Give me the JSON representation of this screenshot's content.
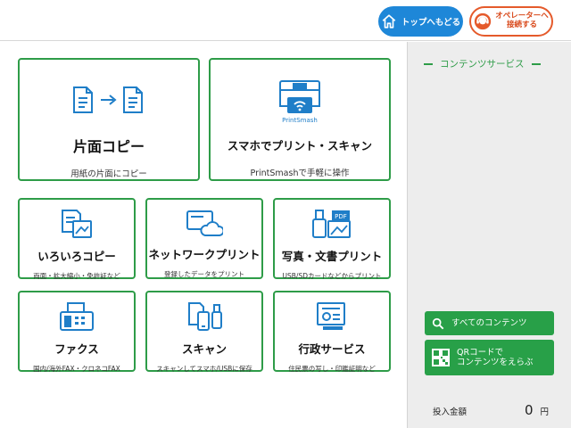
{
  "header": {
    "top_button_label": "トップへもどる",
    "operator_button_label": "オペレーターへ\n接続する"
  },
  "tiles": {
    "single_copy": {
      "title": "片面コピー",
      "desc": "用紙の片面にコピー"
    },
    "smartphone": {
      "title": "スマホでプリント・スキャン",
      "desc": "PrintSmashで手軽に操作",
      "icon_text": "PrintSmash"
    },
    "various_copy": {
      "title": "いろいろコピー",
      "desc": "両面・拡大縮小・免許証など"
    },
    "network_print": {
      "title": "ネットワークプリント",
      "desc": "登録したデータをプリント"
    },
    "photo_print": {
      "title": "写真・文書プリント",
      "desc": "USB/SDカードなどからプリント"
    },
    "fax": {
      "title": "ファクス",
      "desc": "国内/海外FAX・クロネコFAX"
    },
    "scan": {
      "title": "スキャン",
      "desc": "スキャンしてスマホ/USBに保存"
    },
    "admin": {
      "title": "行政サービス",
      "desc": "住民票の写し・印鑑証明など"
    }
  },
  "sidebar": {
    "heading": "コンテンツサービス",
    "all_contents_label": "すべてのコンテンツ",
    "qr_label": "QRコードで\nコンテンツをえらぶ",
    "amount_label": "投入金額",
    "amount_value": "0",
    "amount_unit": "円"
  },
  "colors": {
    "accent_green": "#2e9c48",
    "top_button_blue": "#1e87d8",
    "operator_orange": "#e55a2b",
    "icon_blue": "#1f7ec8"
  }
}
